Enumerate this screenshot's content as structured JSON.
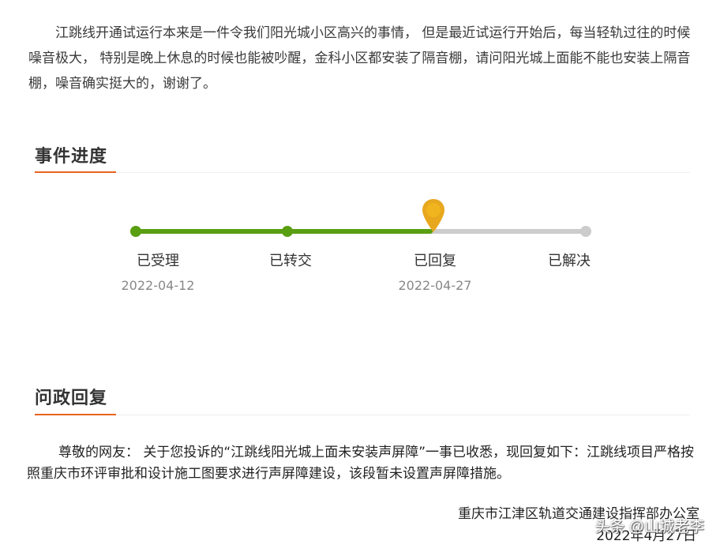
{
  "complaint": {
    "text": "江跳线开通试运行本来是一件令我们阳光城小区高兴的事情， 但是最近试运行开始后，每当轻轨过往的时候噪音极大， 特别是晚上休息的时候也能被吵醒，金科小区都安装了隔音棚，请问阳光城上面能不能也安装上隔音棚，噪音确实挺大的，谢谢了。"
  },
  "progress_section": {
    "title": "事件进度",
    "progress_fraction": 0.66,
    "steps": [
      {
        "label": "已受理",
        "date": "2022-04-12",
        "status": "done"
      },
      {
        "label": "已转交",
        "date": "",
        "status": "done"
      },
      {
        "label": "已回复",
        "date": "2022-04-27",
        "status": "current"
      },
      {
        "label": "已解决",
        "date": "",
        "status": "pending"
      }
    ]
  },
  "reply_section": {
    "title": "问政回复",
    "body": "尊敬的网友： 关于您投诉的“江跳线阳光城上面未安装声屏障”一事已收悉，现回复如下：江跳线项目严格按照重庆市环评审批和设计施工图要求进行声屏障建设，该段暂未设置声屏障措施。",
    "signature": "重庆市江津区轨道交通建设指挥部办公室",
    "date": "2022年4月27日"
  },
  "watermark": "头条 @山城老李",
  "colors": {
    "accent": "#e8641e",
    "progress_done": "#5a9e12",
    "progress_pending": "#cccccc",
    "current_marker": "#e8a81e"
  }
}
